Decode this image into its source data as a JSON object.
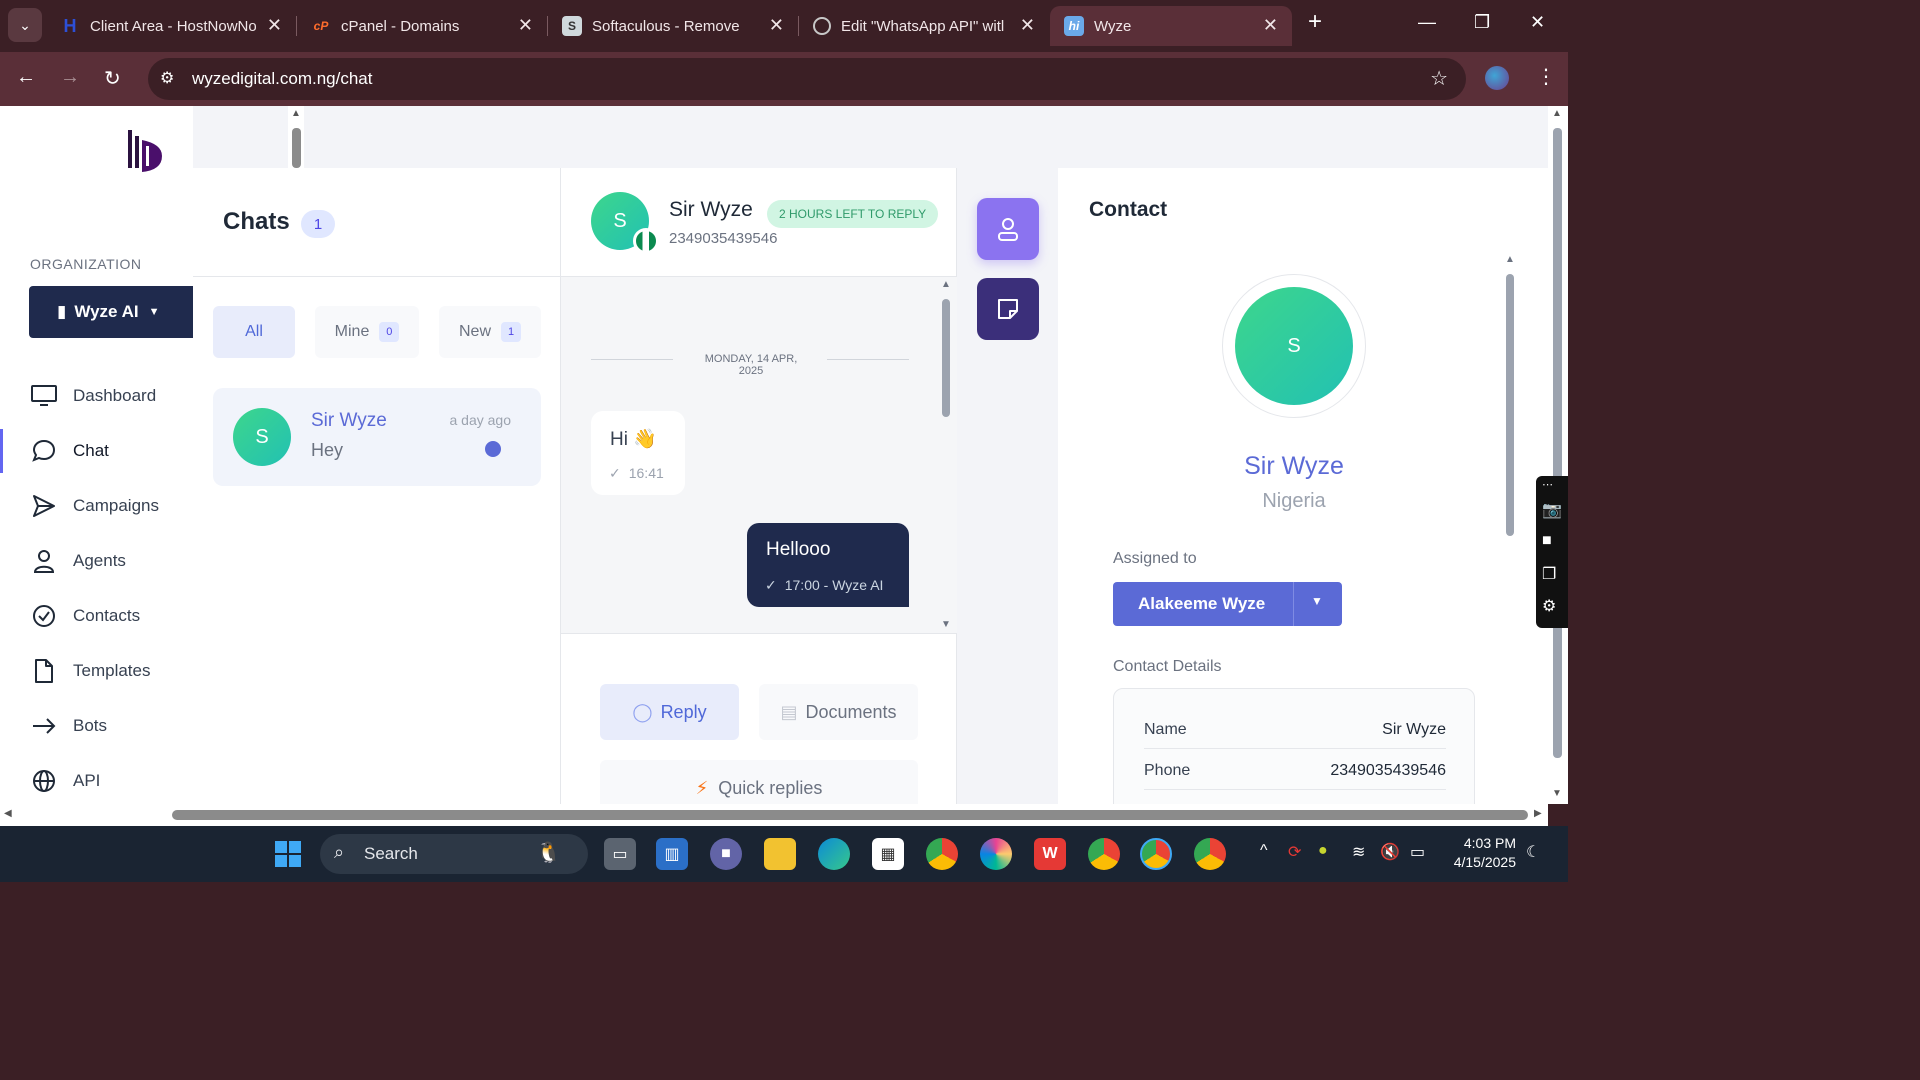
{
  "browser": {
    "tabs": [
      {
        "title": "Client Area - HostNowNo",
        "favicon": "H",
        "color": "#2d4fd6"
      },
      {
        "title": "cPanel - Domains",
        "favicon": "cP",
        "color": "#ff6c2c"
      },
      {
        "title": "Softaculous - Remove",
        "favicon": "S",
        "color": "#cfd8dc"
      },
      {
        "title": "Edit \"WhatsApp API\" witl",
        "favicon": "globe",
        "color": "#9aa0a6"
      },
      {
        "title": "Wyze",
        "favicon": "hi",
        "color": "#6aa9e9"
      }
    ],
    "url": "wyzedigital.com.ng/chat"
  },
  "sidebar": {
    "org_label": "ORGANIZATION",
    "org_name": "Wyze AI",
    "items": [
      {
        "label": "Dashboard",
        "icon": "monitor-icon"
      },
      {
        "label": "Chat",
        "icon": "chat-bubble-icon"
      },
      {
        "label": "Campaigns",
        "icon": "send-icon"
      },
      {
        "label": "Agents",
        "icon": "user-icon"
      },
      {
        "label": "Contacts",
        "icon": "check-circle-icon"
      },
      {
        "label": "Templates",
        "icon": "file-icon"
      },
      {
        "label": "Bots",
        "icon": "arrow-right-icon"
      },
      {
        "label": "API",
        "icon": "globe-icon"
      }
    ]
  },
  "chats": {
    "title": "Chats",
    "count": "1",
    "filters": [
      {
        "label": "All",
        "badge": ""
      },
      {
        "label": "Mine",
        "badge": "0"
      },
      {
        "label": "New",
        "badge": "1"
      }
    ],
    "list": [
      {
        "initial": "S",
        "name": "Sir Wyze",
        "preview": "Hey",
        "time": "a day ago"
      }
    ]
  },
  "conversation": {
    "initial": "S",
    "name": "Sir Wyze",
    "phone": "2349035439546",
    "badge": "2 HOURS LEFT TO REPLY",
    "date": "MONDAY, 14 APR, 2025",
    "messages": [
      {
        "text": "Hi 👋",
        "meta": "16:41"
      },
      {
        "text": "Hellooo",
        "meta": "17:00 - Wyze AI"
      }
    ],
    "reply_label": "Reply",
    "documents_label": "Documents",
    "quick_replies_label": "Quick replies"
  },
  "contact": {
    "title": "Contact",
    "initial": "S",
    "name": "Sir Wyze",
    "country": "Nigeria",
    "assigned_label": "Assigned to",
    "assigned_to": "Alakeeme Wyze",
    "details_label": "Contact Details",
    "details": [
      {
        "key": "Name",
        "value": "Sir Wyze"
      },
      {
        "key": "Phone",
        "value": "2349035439546"
      }
    ]
  },
  "taskbar": {
    "search": "Search",
    "time": "4:03 PM",
    "date": "4/15/2025"
  },
  "colors": {
    "accent": "#5b6ad6",
    "navy": "#1f2a4d",
    "green": "#3dd68c"
  }
}
